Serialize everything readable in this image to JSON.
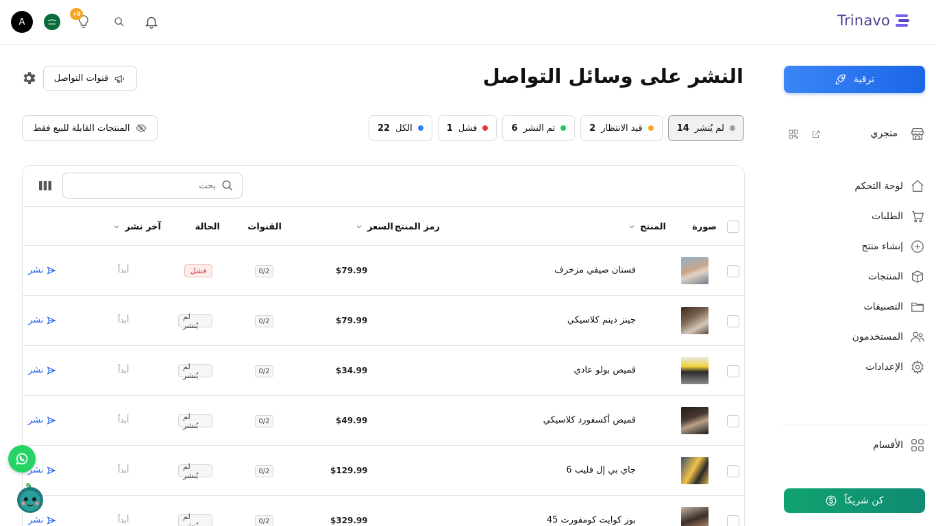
{
  "header": {
    "brand": "Trinavo",
    "avatar_initial": "A",
    "notifications_badge": "+9",
    "icons": [
      "bell-icon",
      "search-icon",
      "lightbulb-icon",
      "saudi-flag-icon"
    ]
  },
  "sidebar": {
    "upgrade_label": "ترقية",
    "store_label": "متجري",
    "items": [
      {
        "label": "لوحة التحكم",
        "icon": "home-icon"
      },
      {
        "label": "الطلبات",
        "icon": "cart-icon"
      },
      {
        "label": "إنشاء منتج",
        "icon": "plus-circle-icon"
      },
      {
        "label": "المنتجات",
        "icon": "box-icon"
      },
      {
        "label": "التصنيفات",
        "icon": "folder-icon"
      },
      {
        "label": "المستخدمون",
        "icon": "users-icon"
      },
      {
        "label": "الإعدادات",
        "icon": "gear-icon"
      }
    ],
    "sections_label": "الأقسام",
    "partner_label": "كن شريكاً"
  },
  "main": {
    "title": "النشر على وسائل التواصل",
    "channels_button": "قنوات التواصل",
    "sellable_only_button": "المنتجات القابلة للبيع فقط",
    "filters": [
      {
        "label": "لم يُنشر",
        "count": "14",
        "color": "#9e9e9e",
        "active": true
      },
      {
        "label": "قيد الانتظار",
        "count": "2",
        "color": "#f5a623",
        "active": false
      },
      {
        "label": "تم النشر",
        "count": "6",
        "color": "#22c55e",
        "active": false
      },
      {
        "label": "فشل",
        "count": "1",
        "color": "#e53935",
        "active": false
      },
      {
        "label": "الكل",
        "count": "22",
        "color": "#2f7cf6",
        "active": false
      }
    ],
    "search_placeholder": "بحث"
  },
  "table": {
    "headers": {
      "image": "صورة",
      "product": "المنتج",
      "sku": "رمز المنتج",
      "price": "السعر",
      "channels": "القنوات",
      "status": "الحالة",
      "last_published": "آخر نشر"
    },
    "rows": [
      {
        "name": "فستان صيفي مزخرف",
        "price": "$79.99",
        "channels": "0/2",
        "status": "فشل",
        "status_type": "fail",
        "last": "أبداً",
        "action": "نشر"
      },
      {
        "name": "جينز دينم كلاسيكي",
        "price": "$79.99",
        "channels": "0/2",
        "status": "لم يُنشر",
        "status_type": "none",
        "last": "أبداً",
        "action": "نشر"
      },
      {
        "name": "قميص بولو عادي",
        "price": "$34.99",
        "channels": "0/2",
        "status": "لم يُنشر",
        "status_type": "none",
        "last": "أبداً",
        "action": "نشر"
      },
      {
        "name": "قميص أكسفورد كلاسيكي",
        "price": "$49.99",
        "channels": "0/2",
        "status": "لم يُنشر",
        "status_type": "none",
        "last": "أبداً",
        "action": "نشر"
      },
      {
        "name": "جاي بي إل فليب 6",
        "price": "$129.99",
        "channels": "0/2",
        "status": "لم يُنشر",
        "status_type": "none",
        "last": "أبداً",
        "action": "نشر"
      },
      {
        "name": "بوز كوايت كومفورت 45",
        "price": "$329.99",
        "channels": "0/2",
        "status": "لم يُنشر",
        "status_type": "none",
        "last": "أبداً",
        "action": "نشر"
      }
    ]
  }
}
